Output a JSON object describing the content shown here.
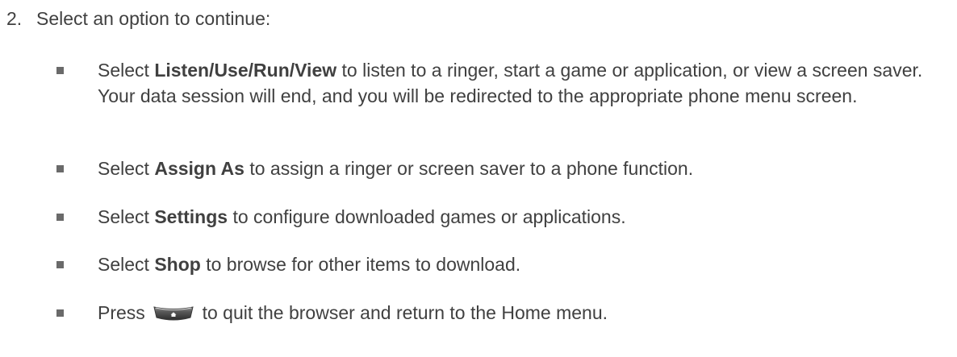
{
  "step": {
    "number": "2.",
    "text": "Select an option to continue:"
  },
  "items": [
    {
      "prefix": "Select ",
      "bold": "Listen/Use/Run/View",
      "suffix": " to listen to a ringer, start a game or application, or view a screen saver. Your data session will end, and you will be redirected to the appropriate phone menu screen."
    },
    {
      "prefix": "Select ",
      "bold": "Assign As",
      "suffix": " to assign a ringer or screen saver to a phone function."
    },
    {
      "prefix": "Select ",
      "bold": "Settings",
      "suffix": " to configure downloaded games or applications."
    },
    {
      "prefix": "Select ",
      "bold": "Shop",
      "suffix": " to browse for other items to download."
    },
    {
      "prefix": "Press ",
      "icon": "home-key-icon",
      "suffix": " to quit the browser and return to the Home menu."
    }
  ]
}
